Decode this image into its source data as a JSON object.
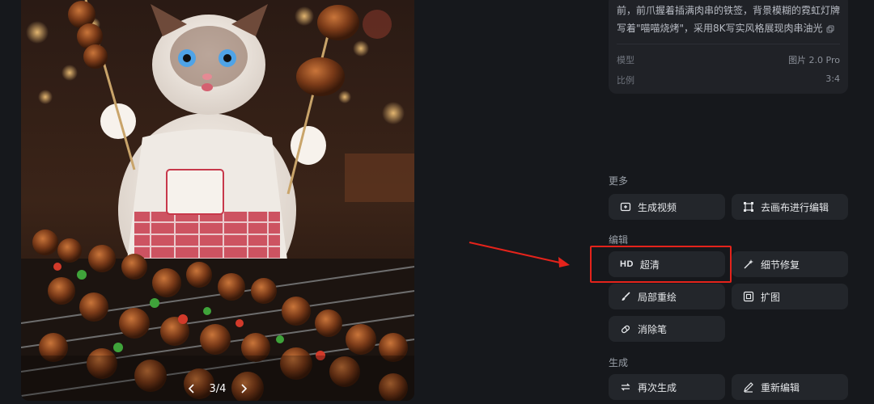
{
  "viewer": {
    "pager": {
      "current": "3",
      "total": "4",
      "text": "3/4"
    }
  },
  "info": {
    "prompt_line1": "前，前爪握着插满肉串的铁签，背景模糊的霓虹灯牌",
    "prompt_line2": "写着\"喵喵烧烤\"，采用8K写实风格展现肉串油光",
    "model_label": "模型",
    "model_value": "图片 2.0 Pro",
    "ratio_label": "比例",
    "ratio_value": "3:4"
  },
  "sections": {
    "more": "更多",
    "edit": "编辑",
    "generate": "生成"
  },
  "buttons": {
    "generate_video": "生成视频",
    "canvas_edit": "去画布进行编辑",
    "hd_badge": "HD",
    "super_res": "超清",
    "detail_fix": "细节修复",
    "inpaint": "局部重绘",
    "expand": "扩图",
    "eraser": "消除笔",
    "regenerate": "再次生成",
    "re_edit": "重新编辑"
  },
  "colors": {
    "background": "#16181c",
    "card": "#202227",
    "button": "#23262b",
    "annotation": "#e4231b"
  }
}
